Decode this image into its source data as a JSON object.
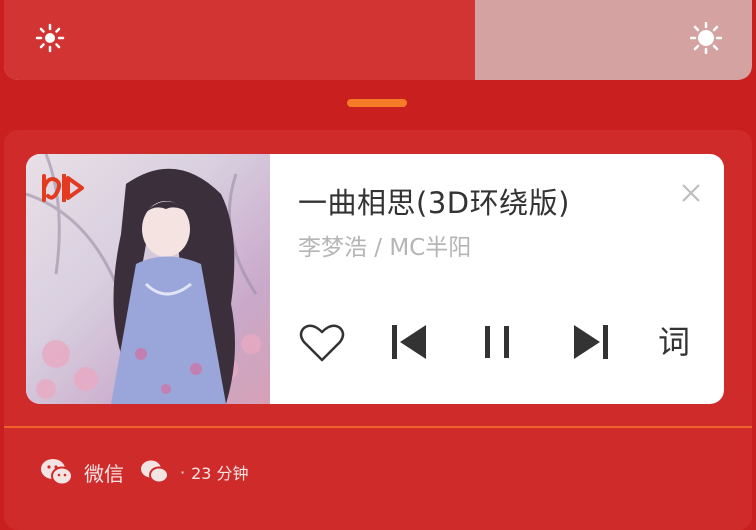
{
  "brightness": {
    "level": 0.63,
    "low_icon": "sun-small-icon",
    "high_icon": "sun-large-icon"
  },
  "player": {
    "title": "一曲相思(3D环绕版)",
    "artist": "李梦浩 / MC半阳",
    "cover_icon": "music-app-logo-icon",
    "controls": {
      "like_icon": "heart-icon",
      "prev_icon": "skip-previous-icon",
      "pause_icon": "pause-icon",
      "next_icon": "skip-next-icon",
      "lyrics_label": "词",
      "close_icon": "close-icon"
    }
  },
  "notification": {
    "app_name": "微信",
    "separator": "·",
    "time": "23 分钟"
  },
  "colors": {
    "background": "#c9201f",
    "panel": "#cf2b2b",
    "accent": "#f57b26",
    "card": "#ffffff"
  }
}
